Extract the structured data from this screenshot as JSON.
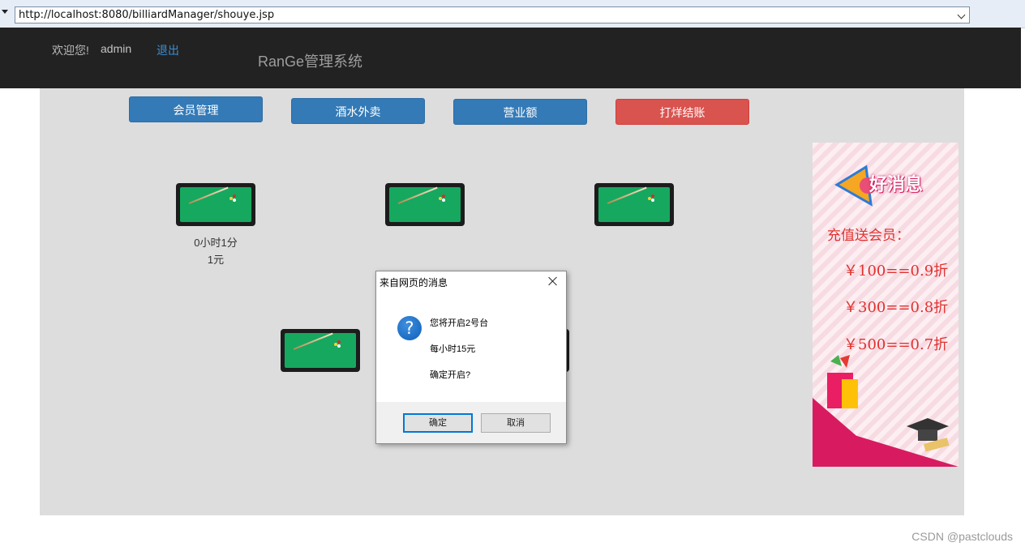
{
  "address_bar": {
    "url": "http://localhost:8080/billiardManager/shouye.jsp"
  },
  "header": {
    "welcome": "欢迎您!",
    "username": "admin",
    "logout": "退出",
    "title": "RanGe管理系统"
  },
  "nav": {
    "member": "会员管理",
    "drinks": "酒水外卖",
    "revenue": "营业额",
    "closing": "打烊结账"
  },
  "tables": [
    {
      "duration": "0小时1分",
      "cost": "1元"
    }
  ],
  "ad": {
    "heading": "好消息",
    "intro": "充值送会员：",
    "offers": [
      "￥100==0.9折",
      "￥300==0.8折",
      "￥500==0.7折"
    ]
  },
  "dialog": {
    "title": "来自网页的消息",
    "line1": "您将开启2号台",
    "line2": "每小时15元",
    "line3": "确定开启?",
    "ok": "确定",
    "cancel": "取消"
  },
  "watermark": "CSDN @pastclouds",
  "colors": {
    "header_bg": "#222222",
    "primary": "#337ab7",
    "danger": "#d9534f",
    "felt": "#16a85f",
    "ad_text": "#e0322f"
  }
}
